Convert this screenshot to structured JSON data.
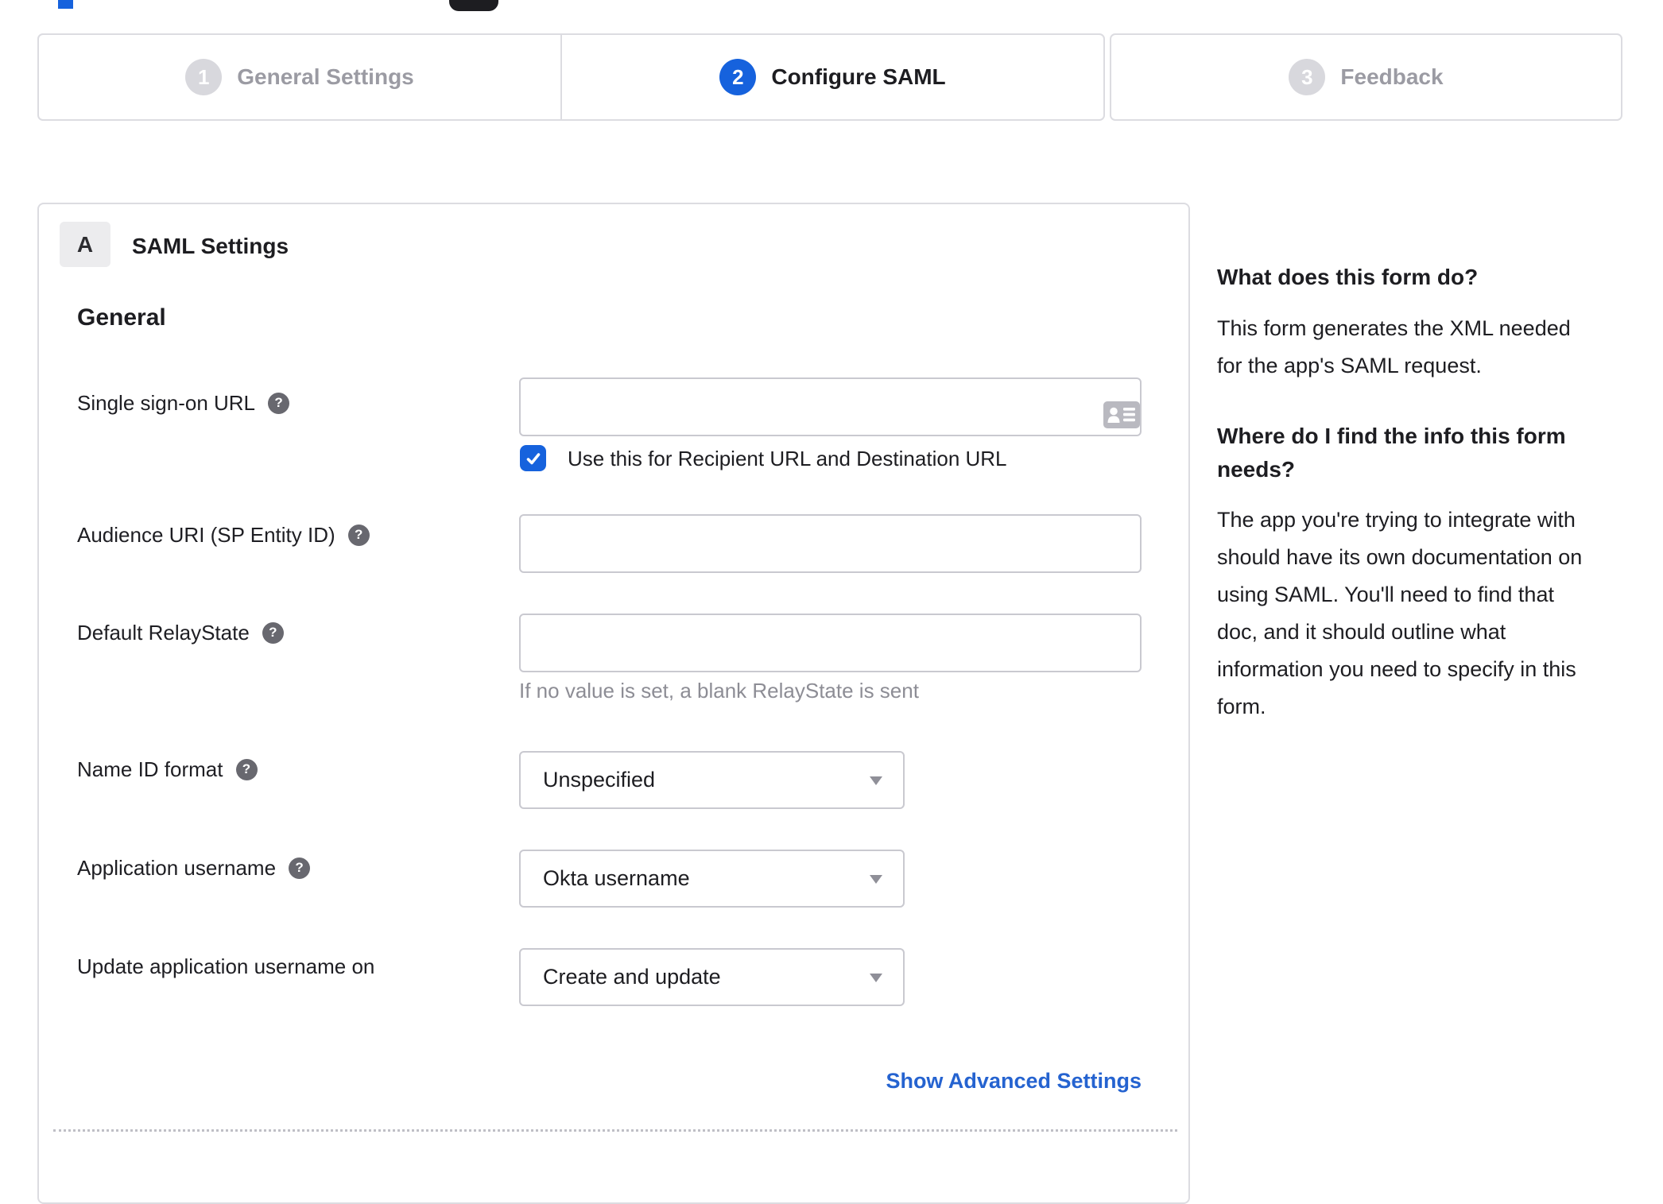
{
  "stepper": {
    "steps": [
      {
        "number": "1",
        "label": "General Settings",
        "state": "inactive"
      },
      {
        "number": "2",
        "label": "Configure SAML",
        "state": "active"
      },
      {
        "number": "3",
        "label": "Feedback",
        "state": "inactive"
      }
    ]
  },
  "panel": {
    "badge": "A",
    "title": "SAML Settings",
    "section": "General",
    "rows": [
      {
        "label": "Single sign-on URL",
        "has_help": true,
        "value": ""
      },
      {
        "label": "Audience URI (SP Entity ID)",
        "has_help": true,
        "value": ""
      },
      {
        "label": "Default RelayState",
        "has_help": true,
        "value": "",
        "hint": "If no value is set, a blank RelayState is sent"
      },
      {
        "label": "Name ID format",
        "has_help": true,
        "value": "Unspecified"
      },
      {
        "label": "Application username",
        "has_help": true,
        "value": "Okta username"
      },
      {
        "label": "Update application username on",
        "has_help": false,
        "value": "Create and update"
      }
    ],
    "checkbox": {
      "label": "Use this for Recipient URL and Destination URL",
      "checked": true
    },
    "advanced_link": "Show Advanced Settings"
  },
  "sidebar": {
    "heading1": "What does this form do?",
    "para1": "This form generates the XML needed\nfor the app's SAML request.",
    "heading2": "Where do I find the info this form\nneeds?",
    "para2": "The app you're trying to integrate with\nshould have its own documentation on\nusing SAML. You'll need to find that\ndoc, and it should outline what\ninformation you need to specify in this\nform."
  },
  "icons": {
    "help_glyph": "?",
    "chevron_down": "▼",
    "checkmark": "✓",
    "contact_card": "contact-card"
  },
  "colors": {
    "accent_blue": "#1662dd",
    "link_blue": "#2563d0",
    "inactive_gray": "#9b9ba3",
    "border_gray": "#dcdce1",
    "control_border": "#c9c9d0",
    "hint_gray": "#8d8d95"
  }
}
